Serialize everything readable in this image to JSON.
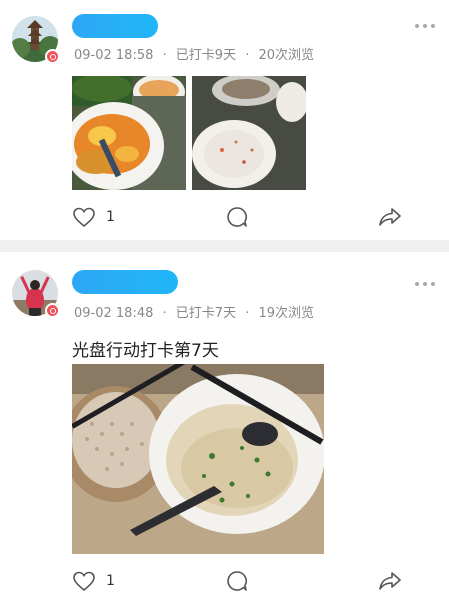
{
  "posts": [
    {
      "time": "09-02 18:58",
      "checkin": "已打卡9天",
      "views": "20次浏览",
      "separator": "·",
      "text": "",
      "likes": "1"
    },
    {
      "time": "09-02 18:48",
      "checkin": "已打卡7天",
      "views": "19次浏览",
      "separator": "·",
      "text": "光盘行动打卡第7天",
      "likes": "1"
    }
  ],
  "colors": {
    "name_redaction": "#2ea7f5",
    "badge": "#f0525a",
    "meta_text": "#888888",
    "divider": "#f0f0f0"
  },
  "icons": [
    "avatar-badge-icon",
    "more-icon",
    "like-icon",
    "comment-icon",
    "share-icon"
  ]
}
